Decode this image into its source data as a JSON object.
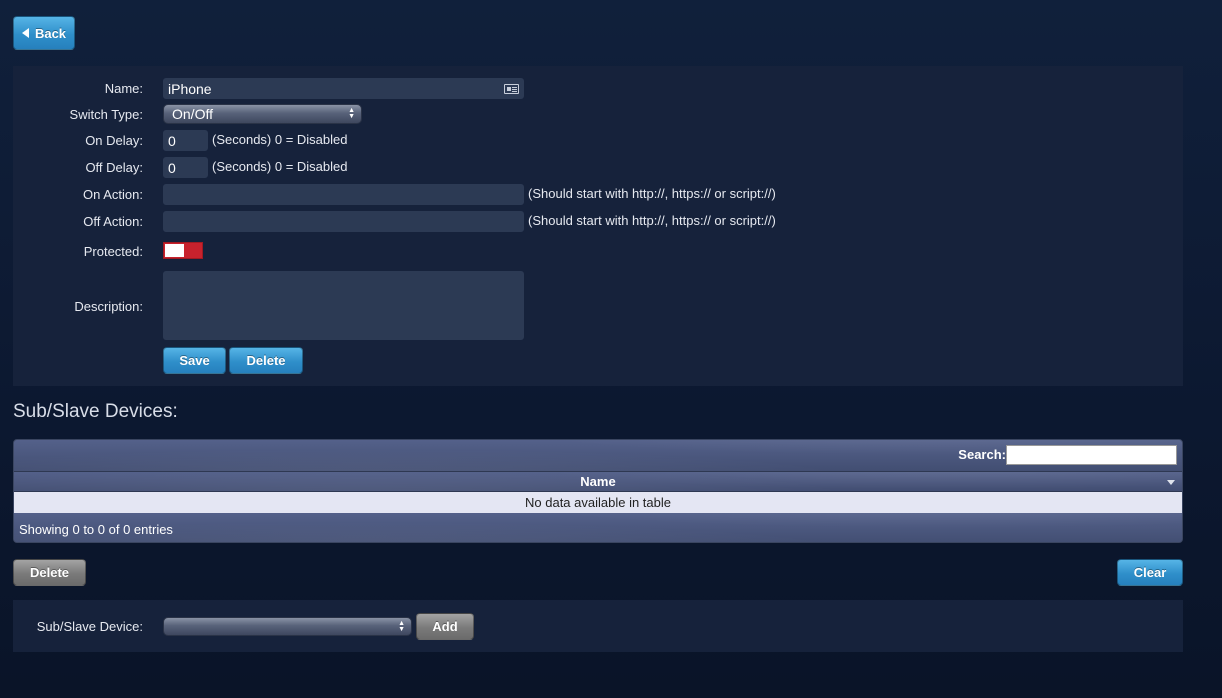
{
  "toolbar": {
    "back_label": "Back"
  },
  "form": {
    "name_label": "Name:",
    "name_value": "iPhone",
    "switch_type_label": "Switch Type:",
    "switch_type_value": "On/Off",
    "on_delay_label": "On Delay:",
    "on_delay_value": "0",
    "on_delay_hint": "(Seconds) 0 = Disabled",
    "off_delay_label": "Off Delay:",
    "off_delay_value": "0",
    "off_delay_hint": "(Seconds) 0 = Disabled",
    "on_action_label": "On Action:",
    "on_action_value": "",
    "on_action_hint": "(Should start with http://, https:// or script://)",
    "off_action_label": "Off Action:",
    "off_action_value": "",
    "off_action_hint": "(Should start with http://, https:// or script://)",
    "protected_label": "Protected:",
    "protected_on": false,
    "description_label": "Description:",
    "description_value": "",
    "save_label": "Save",
    "delete_label": "Delete"
  },
  "sub_devices": {
    "title": "Sub/Slave Devices:",
    "search_label": "Search:",
    "columns": [
      "Name"
    ],
    "empty_text": "No data available in table",
    "showing_text": "Showing 0 to 0 of 0 entries",
    "delete_label": "Delete",
    "clear_label": "Clear"
  },
  "add_device": {
    "label": "Sub/Slave Device:",
    "selected": "",
    "add_label": "Add"
  },
  "colors": {
    "accent_blue": "#2f8fca",
    "toggle_off_red": "#c8222d",
    "panel_bg": "#16223b"
  },
  "icons": [
    "chevron-left-icon",
    "contact-card-icon",
    "select-arrows-icon",
    "sort-down-icon"
  ]
}
